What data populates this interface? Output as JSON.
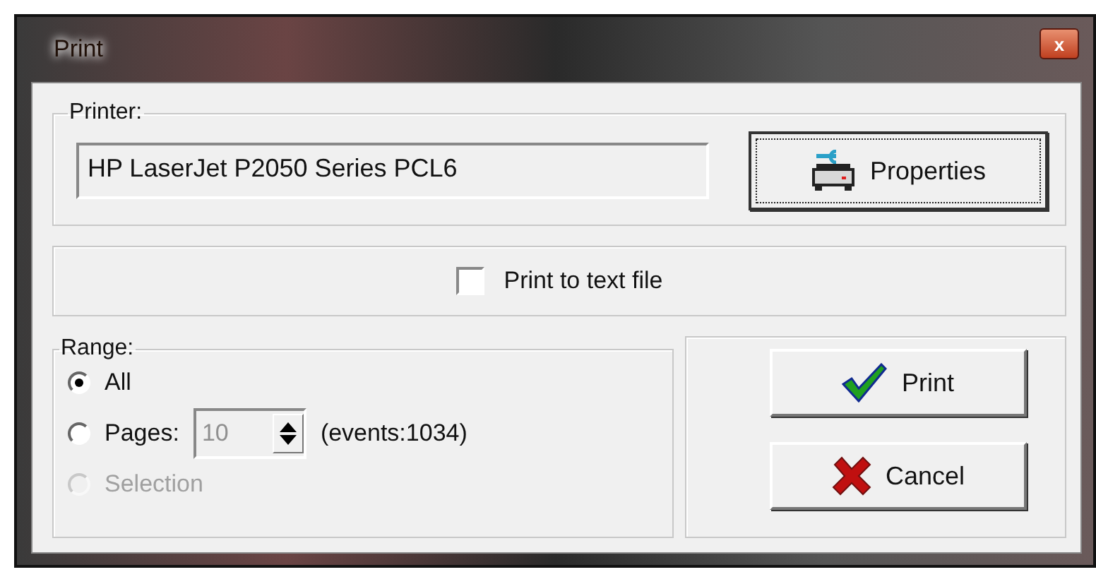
{
  "window": {
    "title": "Print",
    "close_label": "x"
  },
  "printer": {
    "legend": "Printer:",
    "name": "HP LaserJet P2050 Series PCL6",
    "properties_button": "Properties"
  },
  "print_to_file": {
    "label": "Print to text file",
    "checked": false
  },
  "range": {
    "legend": "Range:",
    "options": [
      {
        "kind": "plain",
        "label": "All",
        "selected": true,
        "disabled": false
      },
      {
        "kind": "pages",
        "label": "Pages:",
        "selected": false,
        "disabled": false,
        "value": "10",
        "note": "(events:1034)"
      },
      {
        "kind": "plain",
        "label": "Selection",
        "selected": false,
        "disabled": true
      }
    ]
  },
  "buttons": [
    {
      "kind": "ok",
      "label": "Print"
    },
    {
      "kind": "cancel",
      "label": "Cancel"
    }
  ]
}
